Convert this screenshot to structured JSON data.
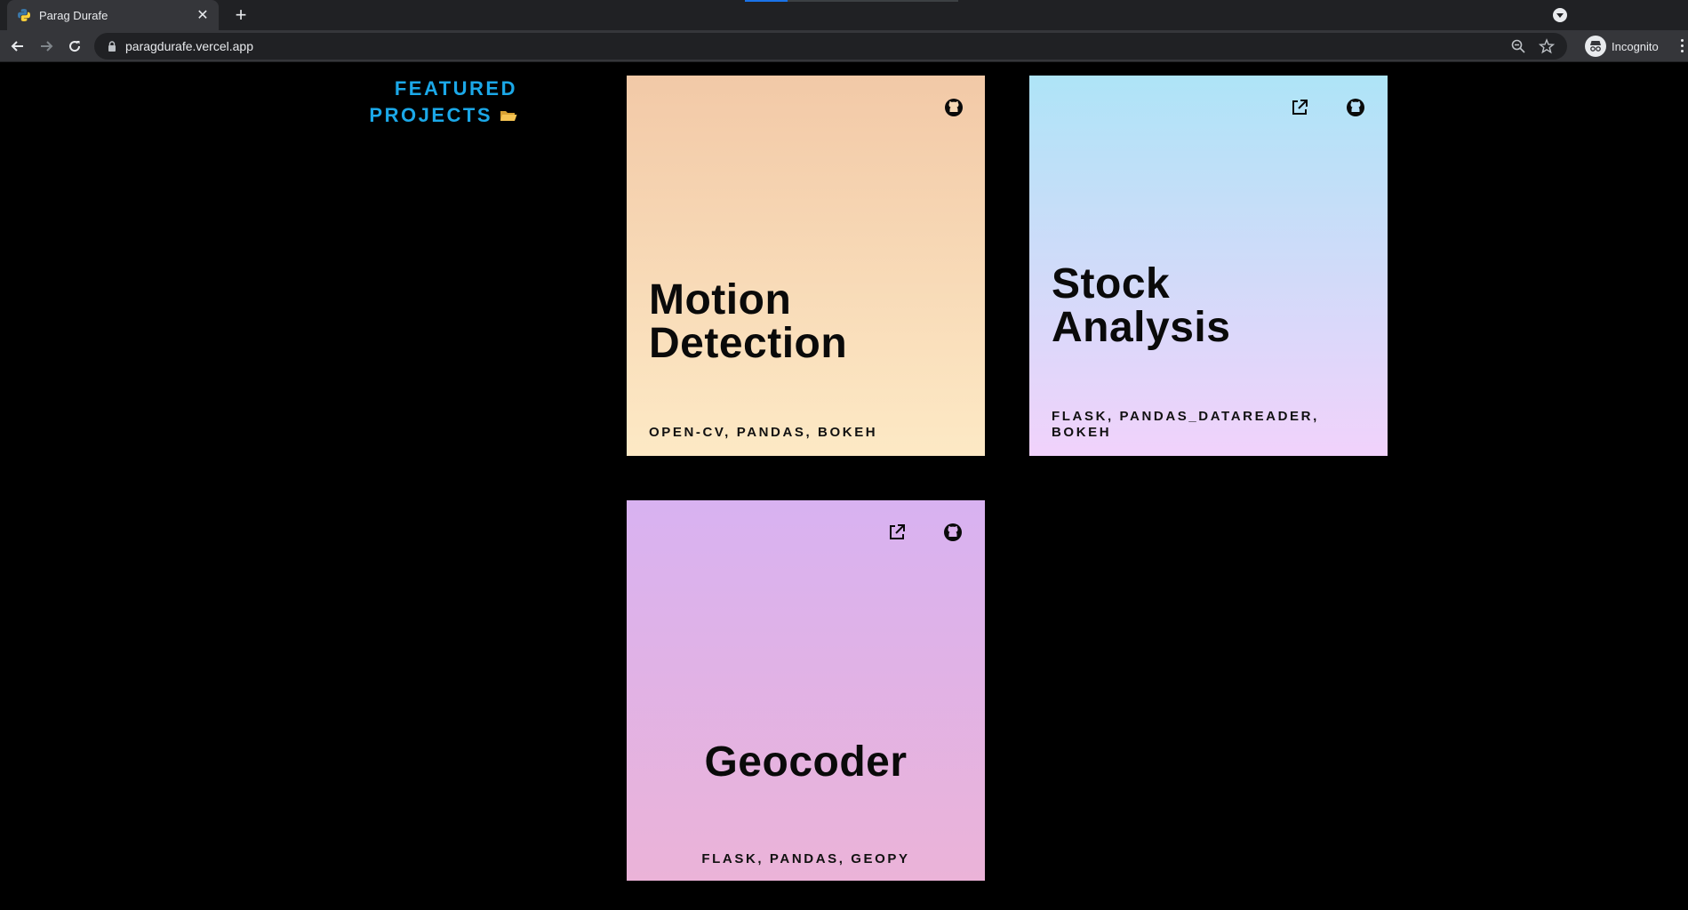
{
  "browser": {
    "tab_title": "Parag Durafe",
    "url": "paragdurafe.vercel.app",
    "profile_label": "Incognito"
  },
  "page": {
    "heading_line1": "FEATURED",
    "heading_line2": "PROJECTS",
    "accent_color": "#1ba8e8",
    "projects": [
      {
        "title_line1": "Motion",
        "title_line2": "Detection",
        "tags": "OPEN-CV, PANDAS, BOKEH",
        "icons": [
          "github-icon"
        ]
      },
      {
        "title_line1": "Stock",
        "title_line2": "Analysis",
        "tags_line1": "FLASK, PANDAS_DATAREADER,",
        "tags_line2": "BOKEH",
        "icons": [
          "external-link-icon",
          "github-icon"
        ]
      },
      {
        "title_line1": "Geocoder",
        "tags": "FLASK, PANDAS, GEOPY",
        "icons": [
          "external-link-icon",
          "github-icon"
        ]
      }
    ]
  }
}
